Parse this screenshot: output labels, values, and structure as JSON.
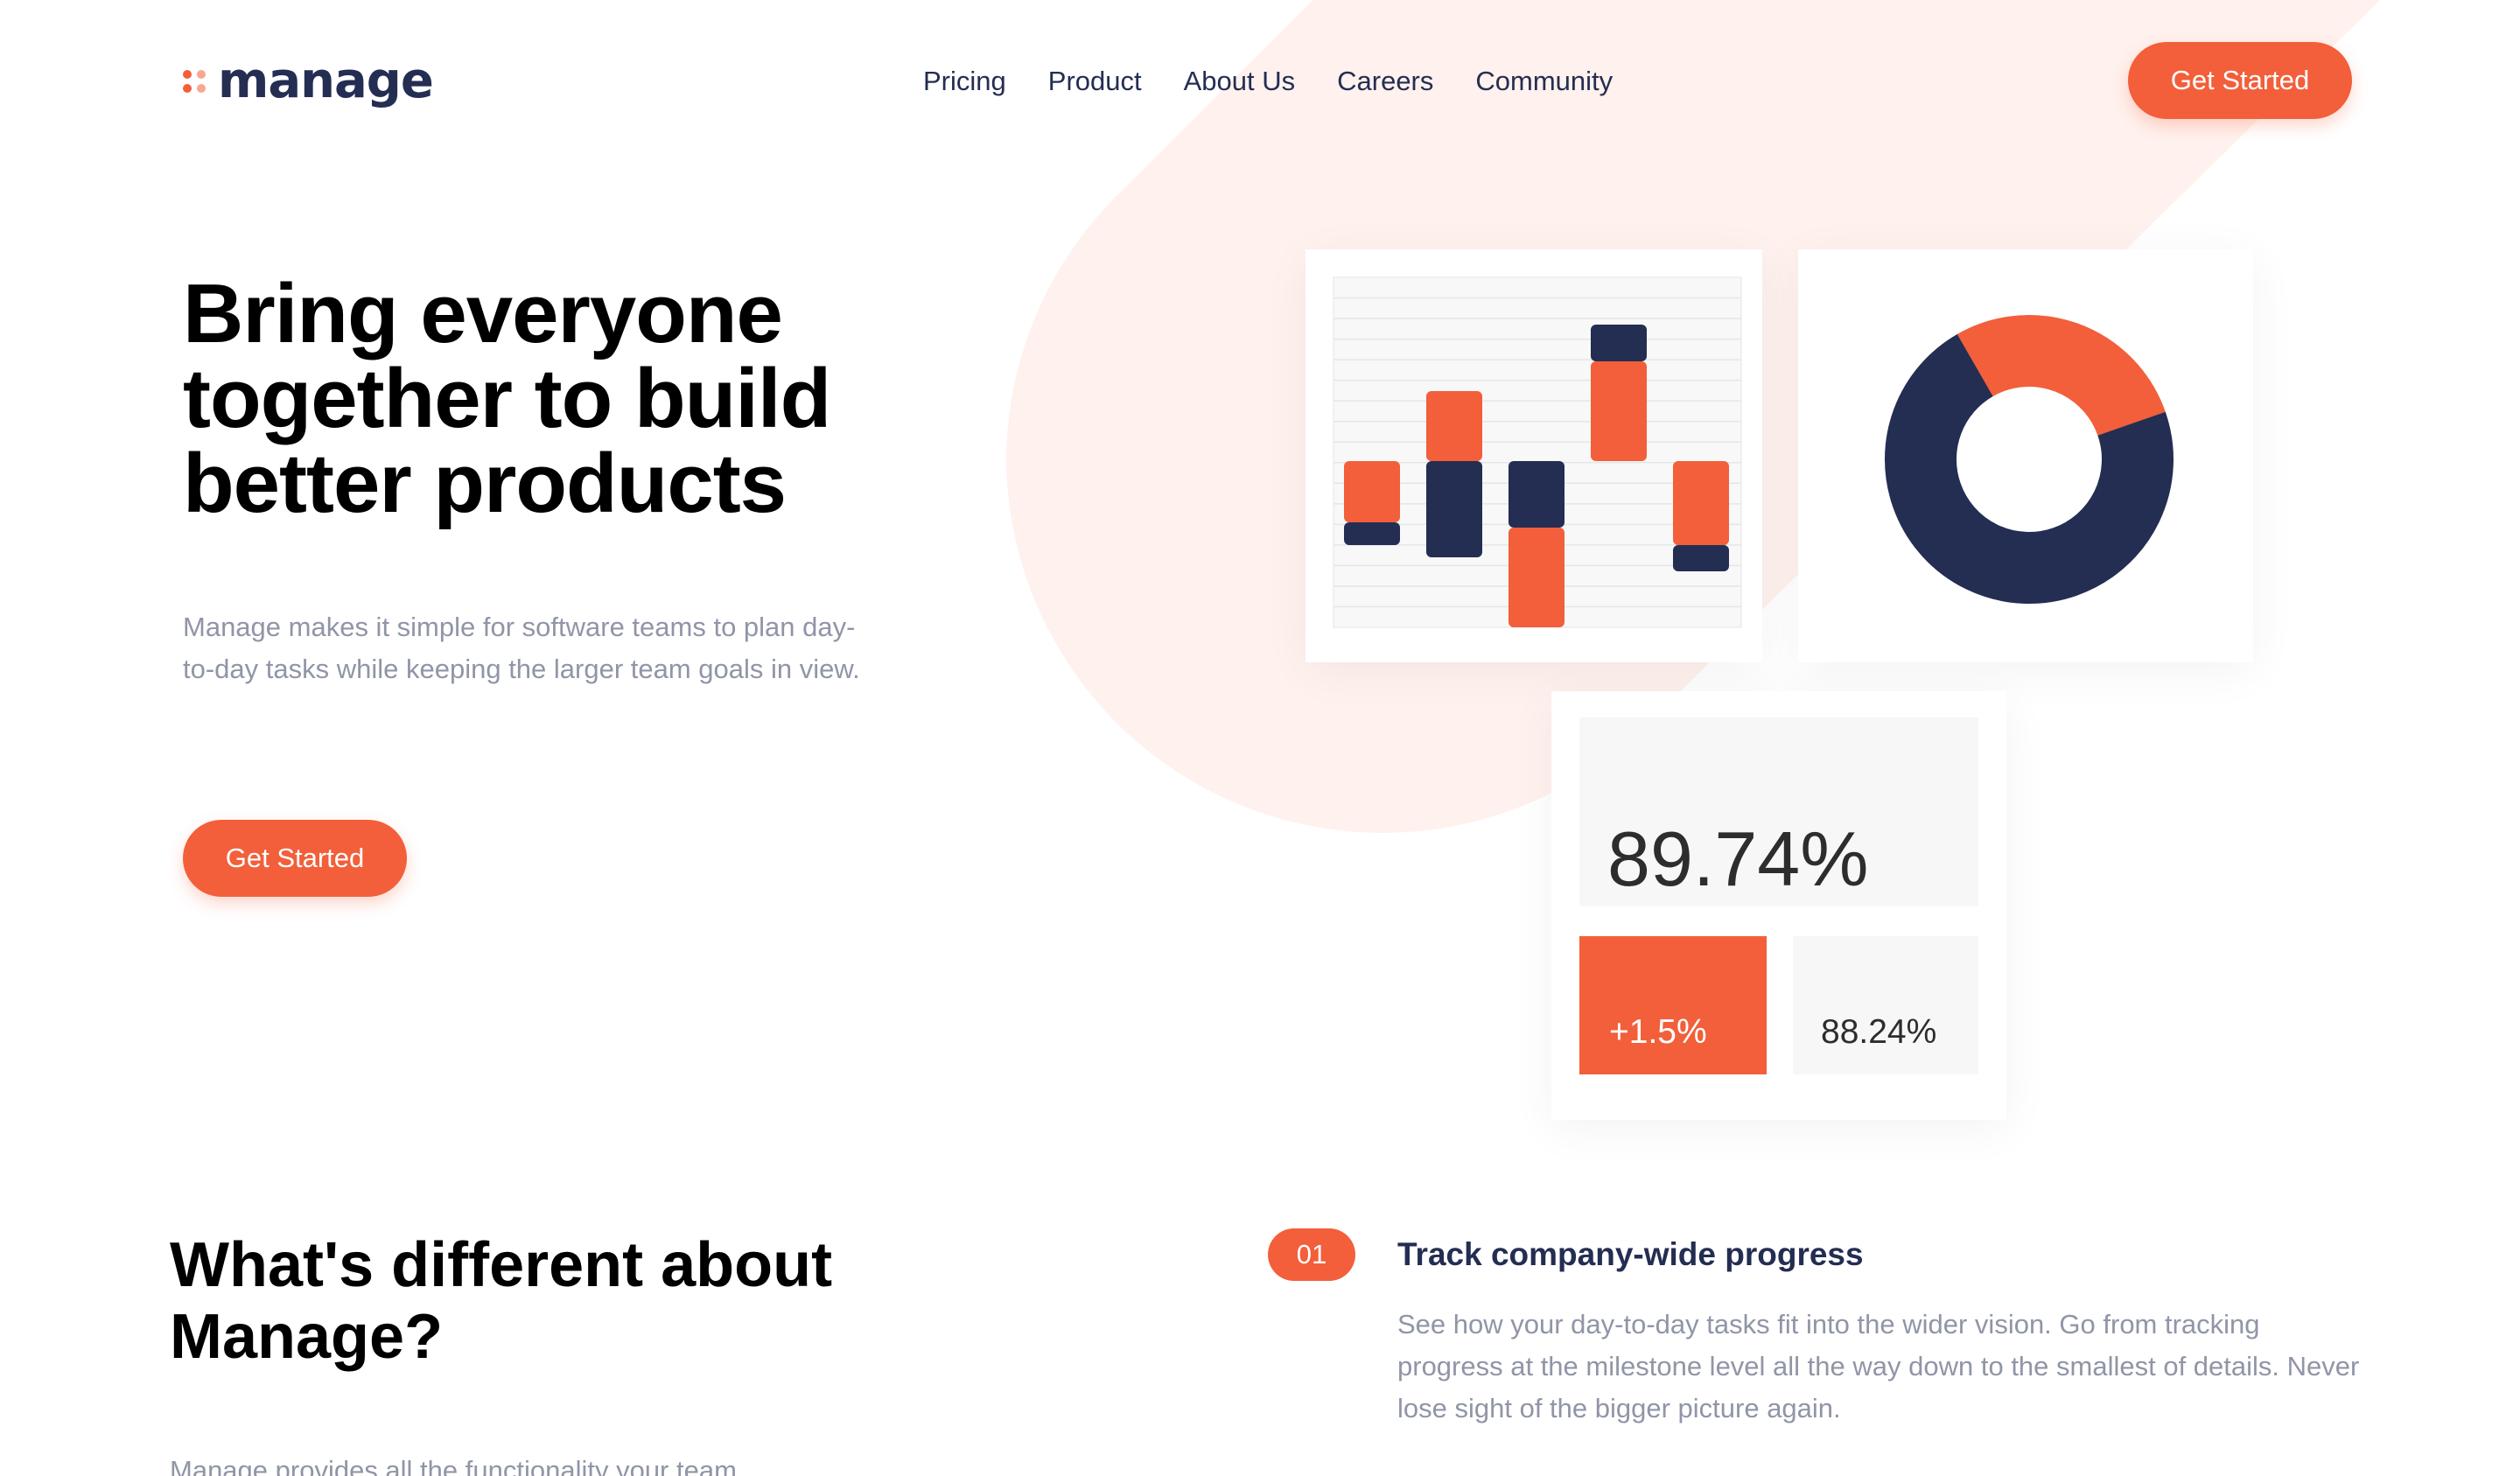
{
  "brand": {
    "name": "manage",
    "accent_color": "#f25f3a",
    "dark_color": "#242d52",
    "background_shape_color": "#fff1ed"
  },
  "nav": {
    "items": [
      {
        "label": "Pricing"
      },
      {
        "label": "Product"
      },
      {
        "label": "About Us"
      },
      {
        "label": "Careers"
      },
      {
        "label": "Community"
      }
    ]
  },
  "header": {
    "cta_label": "Get Started"
  },
  "hero": {
    "title": "Bring everyone together to build better products",
    "description": "Manage makes it simple for software teams to plan day-to-day tasks while keeping the larger team goals in view.",
    "cta_label": "Get Started"
  },
  "dashboard": {
    "bar_chart": {
      "type": "bar",
      "orange": "#f25f3a",
      "navy": "#242d52",
      "bars": [
        {
          "orange": [
            -0.35,
            0
          ],
          "navy": [
            -0.48,
            -0.35
          ]
        },
        {
          "orange": [
            0,
            0.4
          ],
          "navy": [
            -0.55,
            0
          ]
        },
        {
          "orange": [
            -0.95,
            -0.38
          ],
          "navy": [
            -0.38,
            0
          ]
        },
        {
          "orange": [
            0,
            0.57
          ],
          "navy": [
            0.57,
            0.78
          ]
        },
        {
          "orange": [
            -0.48,
            0
          ],
          "navy": [
            -0.63,
            -0.48
          ]
        }
      ]
    },
    "donut_chart": {
      "type": "pie",
      "slices": [
        {
          "value": 28,
          "color": "#f25f3a"
        },
        {
          "value": 72,
          "color": "#242d52"
        }
      ]
    },
    "stats": {
      "main_value": "89.74%",
      "change_value": "+1.5%",
      "secondary_value": "88.24%"
    }
  },
  "features": {
    "title": "What's different about Manage?",
    "description": "Manage provides all the functionality your team",
    "items": [
      {
        "number": "01",
        "title": "Track company-wide progress",
        "description": "See how your day-to-day tasks fit into the wider vision. Go from tracking progress at the milestone level all the way down to the smallest of details. Never lose sight of the bigger picture again."
      }
    ]
  }
}
